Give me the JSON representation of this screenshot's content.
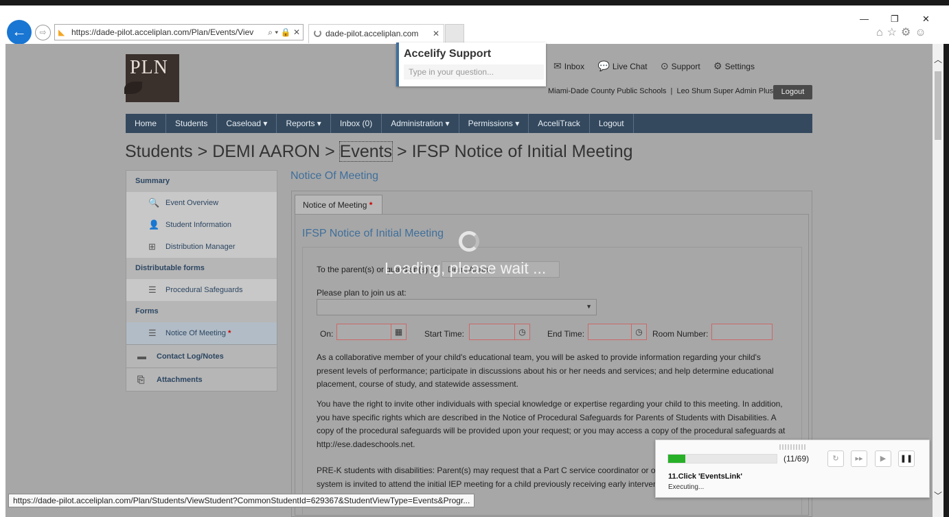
{
  "browser": {
    "url": "https://dade-pilot.acceliplan.com/Plan/Events/Viev",
    "tab_title": "dade-pilot.acceliplan.com",
    "tab_close": "✕",
    "back_icon": "←",
    "forward_icon": "⇨",
    "window_controls": {
      "minimize": "—",
      "restore": "❐",
      "close": "✕"
    },
    "right_icons": "⌂☆⚙☺",
    "status_url": "https://dade-pilot.acceliplan.com/Plan/Students/ViewStudent?CommonStudentId=629367&StudentViewType=Events&Progr..."
  },
  "header": {
    "logo_text": "PLN",
    "top_nav": [
      {
        "icon": "✉",
        "label": "Inbox"
      },
      {
        "icon": "💬",
        "label": "Live Chat"
      },
      {
        "icon": "⊙",
        "label": "Support"
      },
      {
        "icon": "⚙",
        "label": "Settings"
      }
    ],
    "district": "Miami-Dade County Public Schools",
    "separator": "|",
    "user": "Leo Shum Super Admin Plus",
    "logout_button": "Logout"
  },
  "support_widget": {
    "title": "Accelify Support",
    "placeholder": "Type in your question..."
  },
  "nav": [
    "Home",
    "Students",
    "Caseload ▾",
    "Reports ▾",
    "Inbox (0)",
    "Administration ▾",
    "Permissions ▾",
    "AcceliTrack",
    "Logout"
  ],
  "breadcrumb": {
    "students": "Students",
    "sep": " > ",
    "student": "DEMI AARON",
    "events": "Events",
    "current": "IFSP Notice of Initial Meeting"
  },
  "sidebar": {
    "summary_header": "Summary",
    "summary_items": [
      {
        "icon": "🔍",
        "label": "Event Overview"
      },
      {
        "icon": "👤",
        "label": "Student Information"
      },
      {
        "icon": "⊞",
        "label": "Distribution Manager"
      }
    ],
    "distributable_header": "Distributable forms",
    "distributable_items": [
      {
        "icon": "☰",
        "label": "Procedural Safeguards"
      }
    ],
    "forms_header": "Forms",
    "forms_items": [
      {
        "icon": "☰",
        "label": "Notice Of Meeting",
        "required": "*"
      }
    ],
    "contact_log": {
      "icon": "▬",
      "label": "Contact Log/Notes"
    },
    "attachments": {
      "icon": "⎘",
      "label": "Attachments"
    }
  },
  "main": {
    "section_title": "Notice Of Meeting",
    "form_tab": "Notice of Meeting",
    "form_tab_required": "*",
    "form_title": "IFSP Notice of Initial Meeting",
    "to_parents_label": "To the parent(s) or guardian(s) of",
    "student_name_field": "Demi Aaron",
    "plan_label": "Please plan to join us at:",
    "on_label": "On:",
    "start_label": "Start Time:",
    "end_label": "End Time:",
    "room_label": "Room Number:",
    "calendar_icon": "▦",
    "clock_icon": "◷",
    "para1": "As a collaborative member of your child's educational team, you will be asked to provide information regarding your child's present levels of performance; participate in discussions about his or her needs and services; and help determine educational placement, course of study, and statewide assessment.",
    "para2": "You have the right to invite other individuals with special knowledge or expertise regarding your child to this meeting. In addition, you have specific rights which are described in the Notice of Procedural Safeguards for Parents of Students with Disabilities. A copy of the procedural safeguards will be provided upon your request; or you may access a copy of the procedural safeguards at http://ese.dadeschools.net.",
    "para3": "PRE-K students with disabilities: Parent(s) may request that a Part C service coordinator or other representatives of the Part C system is invited to attend the initial IEP meeting for a child previously receiving early intervention services under Part C of IDEA."
  },
  "loading": {
    "text": "Loading, please wait ..."
  },
  "automation_panel": {
    "progress_fraction": 0.159,
    "count": "(11/69)",
    "step": "11.Click 'EventsLink'",
    "state": "Executing...",
    "buttons": {
      "reload": "↻",
      "skip": "▸▸",
      "play": "▶",
      "pause": "❚❚"
    }
  }
}
